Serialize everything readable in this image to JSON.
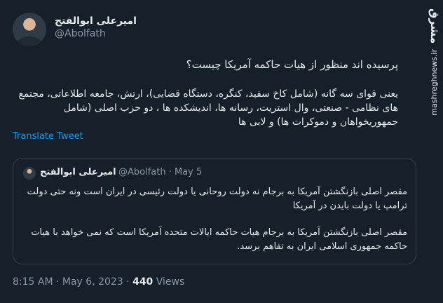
{
  "author": {
    "display_name": "امیرعلی ابوالفتح",
    "handle": "@Abolfath"
  },
  "tweet": {
    "paragraph1": "پرسیده اند منظور از هیات حاکمه آمریکا چیست؟",
    "paragraph2": "یعنی قوای سه گانه (شامل کاخ سفید، کنگره، دستگاه قضایی)، ارتش، جامعه اطلاعاتی، مجتمع های نظامی - صنعتی، وال استریت، رسانه ها، اندیشکده ها ، دو حزب اصلی (شامل جمهوریخواهان و دموکرات ها) و لابی ها",
    "translate_label": "Translate Tweet"
  },
  "quote": {
    "display_name": "امیرعلی ابوالفتح",
    "meta": "@Abolfath · May 5",
    "paragraph1": "مقصر اصلی بازنگشتن آمریکا به برجام نه دولت روحانی یا دولت رئیسی در ایران است ونه حتی دولت ترامپ یا دولت بایدن در آمریکا",
    "paragraph2": "مقصر اصلی بازنگشتن آمریکا به برجام هیات حاکمه ایالات متحده آمریکا است که نمی خواهد با هیات حاکمه جمهوری اسلامی ایران به تفاهم برسد."
  },
  "footer": {
    "timestamp": "8:15 AM · May 6, 2023 · ",
    "views_count": "440",
    "views_label": " Views"
  },
  "watermark": {
    "logo": "مشرق",
    "url": "mashreghnews.ir"
  }
}
